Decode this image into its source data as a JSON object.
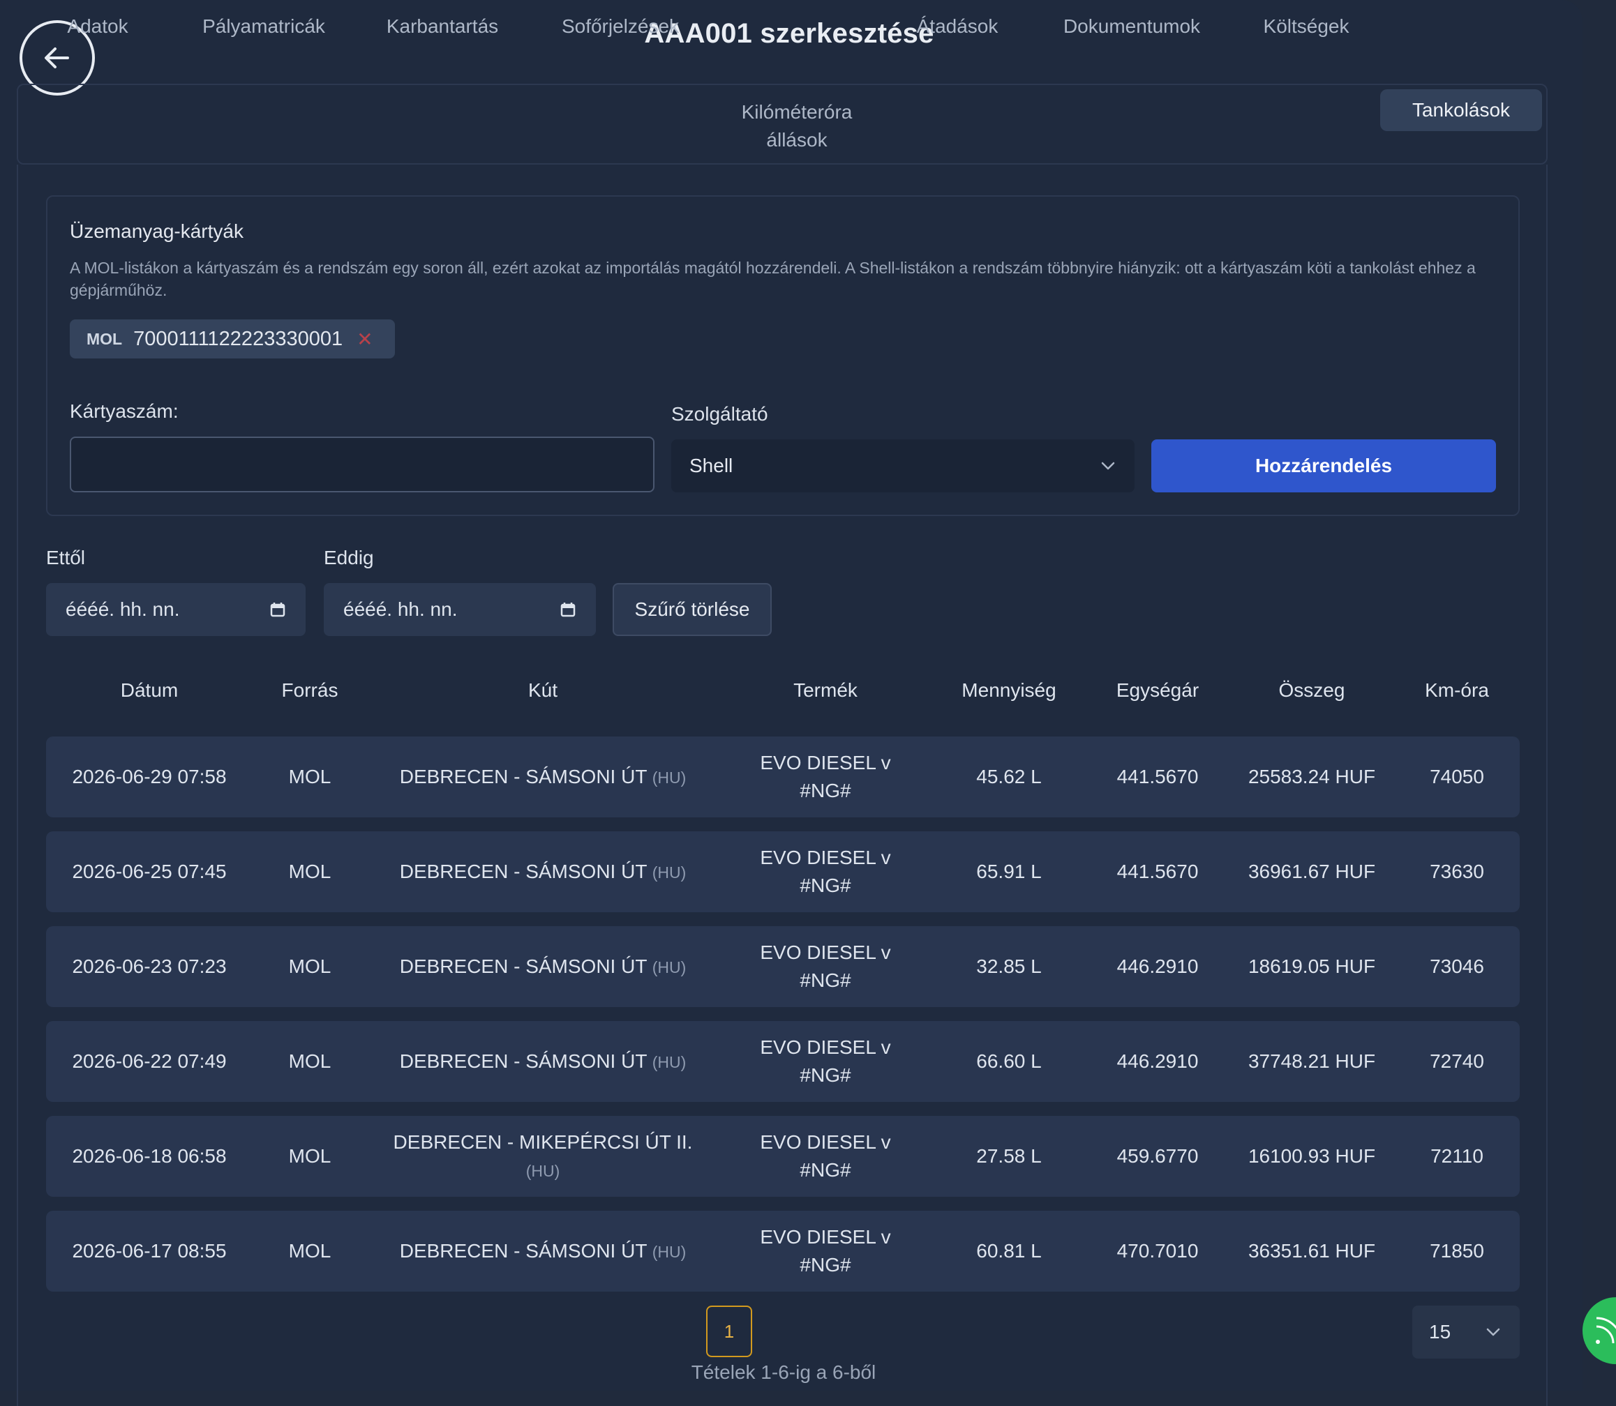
{
  "header": {
    "title": "AAA001 szerkesztése",
    "back_icon": "arrow-left-circle"
  },
  "tabs": [
    {
      "label": "Adatok"
    },
    {
      "label": "Pályamatricák"
    },
    {
      "label": "Karbantartás"
    },
    {
      "label": "Sofőrjelzések"
    },
    {
      "label": "Kilóméteróra",
      "label2": "állások"
    },
    {
      "label": "Átadások"
    },
    {
      "label": "Dokumentumok"
    },
    {
      "label": "Költségek"
    },
    {
      "label": "Tankolások",
      "active": true
    }
  ],
  "fuel_cards": {
    "title": "Üzemanyag-kártyák",
    "description": "A MOL-listákon a kártyaszám és a rendszám egy soron áll, ezért azokat az importálás magától hozzárendeli. A Shell-listákon a rendszám többnyire hiányzik: ott a kártyaszám köti a tankolást ehhez a gépjárműhöz.",
    "chip": {
      "provider": "MOL",
      "number": "7000111122223330001",
      "remove": "✕"
    },
    "card_number_label": "Kártyaszám:",
    "card_number_value": "",
    "provider_label": "Szolgáltató",
    "provider_value": "Shell",
    "assign_button": "Hozzárendelés"
  },
  "filters": {
    "from_label": "Ettől",
    "from_placeholder": "éééé. hh. nn.",
    "to_label": "Eddig",
    "to_placeholder": "éééé. hh. nn.",
    "clear_button": "Szűrő törlése"
  },
  "table": {
    "headers": [
      "Dátum",
      "Forrás",
      "Kút",
      "Termék",
      "Mennyiség",
      "Egységár",
      "Összeg",
      "Km-óra"
    ],
    "rows": [
      {
        "date": "2026-06-29 07:58",
        "source": "MOL",
        "station": "DEBRECEN - SÁMSONI ÚT",
        "country": "(HU)",
        "product1": "EVO DIESEL v",
        "product2": "#NG#",
        "qty": "45.62 L",
        "unit_price": "441.5670",
        "total": "25583.24 HUF",
        "km": "74050"
      },
      {
        "date": "2026-06-25 07:45",
        "source": "MOL",
        "station": "DEBRECEN - SÁMSONI ÚT",
        "country": "(HU)",
        "product1": "EVO DIESEL v",
        "product2": "#NG#",
        "qty": "65.91 L",
        "unit_price": "441.5670",
        "total": "36961.67 HUF",
        "km": "73630"
      },
      {
        "date": "2026-06-23 07:23",
        "source": "MOL",
        "station": "DEBRECEN - SÁMSONI ÚT",
        "country": "(HU)",
        "product1": "EVO DIESEL v",
        "product2": "#NG#",
        "qty": "32.85 L",
        "unit_price": "446.2910",
        "total": "18619.05 HUF",
        "km": "73046"
      },
      {
        "date": "2026-06-22 07:49",
        "source": "MOL",
        "station": "DEBRECEN - SÁMSONI ÚT",
        "country": "(HU)",
        "product1": "EVO DIESEL v",
        "product2": "#NG#",
        "qty": "66.60 L",
        "unit_price": "446.2910",
        "total": "37748.21 HUF",
        "km": "72740"
      },
      {
        "date": "2026-06-18 06:58",
        "source": "MOL",
        "station": "DEBRECEN - MIKEPÉRCSI ÚT II.",
        "country": "(HU)",
        "product1": "EVO DIESEL v",
        "product2": "#NG#",
        "qty": "27.58 L",
        "unit_price": "459.6770",
        "total": "16100.93 HUF",
        "km": "72110"
      },
      {
        "date": "2026-06-17 08:55",
        "source": "MOL",
        "station": "DEBRECEN - SÁMSONI ÚT",
        "country": "(HU)",
        "product1": "EVO DIESEL v",
        "product2": "#NG#",
        "qty": "60.81 L",
        "unit_price": "470.7010",
        "total": "36351.61 HUF",
        "km": "71850"
      }
    ]
  },
  "pagination": {
    "current_page": "1",
    "info": "Tételek 1-6-ig a 6-ből",
    "page_size": "15"
  },
  "colors": {
    "background": "#1f2a3e",
    "accent": "#2f56cc",
    "row": "#293650",
    "active_page": "#d39a1e",
    "remove": "#b8414a",
    "fab": "#2bbd5b"
  }
}
